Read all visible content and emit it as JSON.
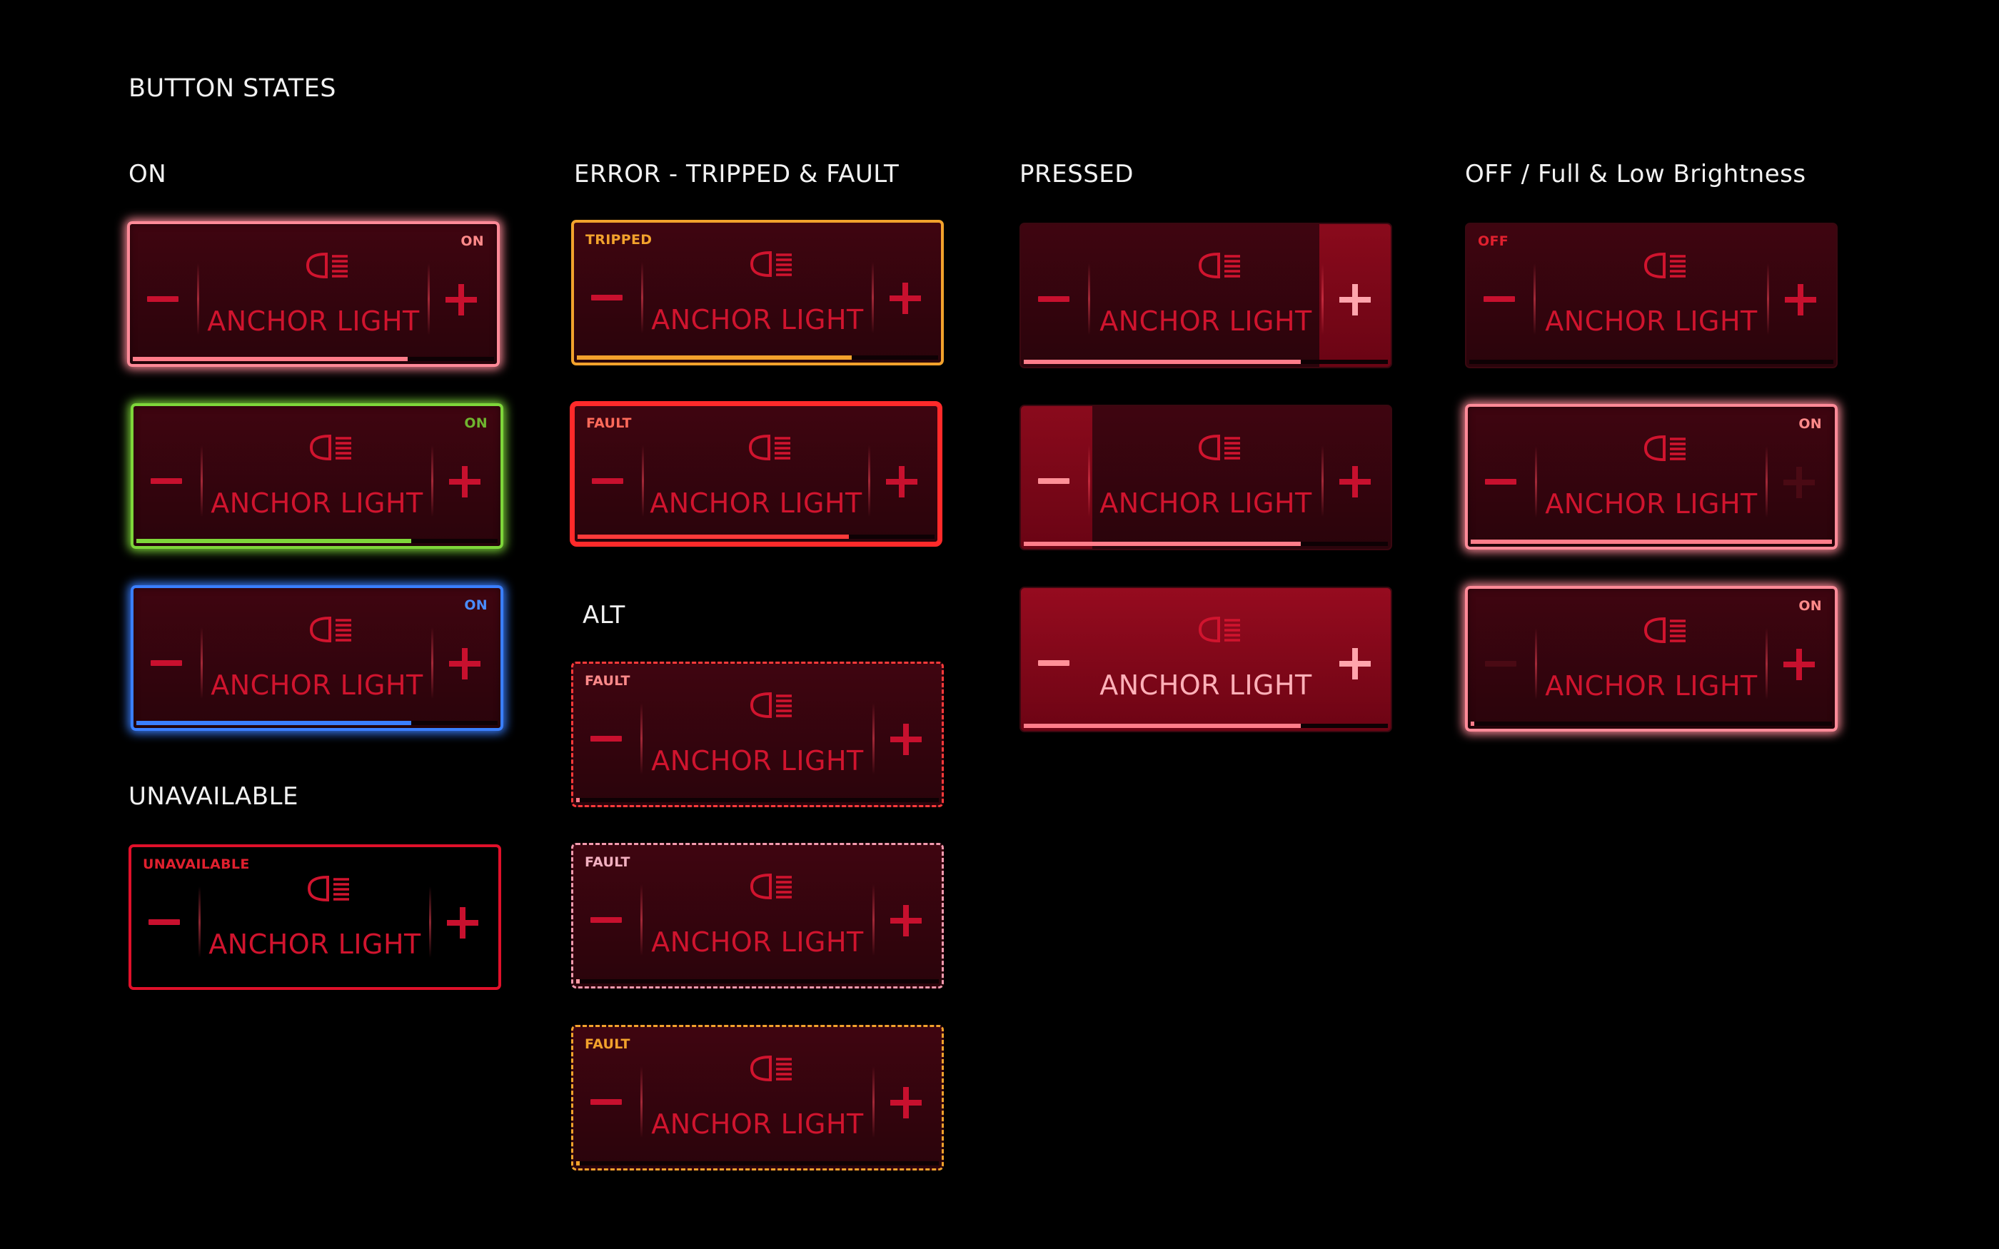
{
  "page_title": "BUTTON STATES",
  "sections": {
    "on": "ON",
    "error": "ERROR - TRIPPED & FAULT",
    "pressed": "PRESSED",
    "off_brightness": "OFF / Full & Low Brightness",
    "alt": "ALT",
    "unavailable": "UNAVAILABLE"
  },
  "button_label": "ANCHOR LIGHT",
  "icon": "headlight-icon",
  "colors": {
    "label_red": "#d0142e",
    "red_glow": "#ff8090",
    "green": "#7ed63a",
    "blue": "#3a7fff",
    "amber": "#f2a22c",
    "fault_red": "#ff2a2a",
    "pink": "#f29aae",
    "unavailable_red": "#e0102a"
  },
  "buttons": [
    {
      "id": "on-red",
      "section": "on",
      "badge": "ON",
      "badge_color": "#ff8a8a",
      "border_color": "#ff8a98",
      "level": 0.76
    },
    {
      "id": "on-green",
      "section": "on",
      "badge": "ON",
      "badge_color": "#6fb52f",
      "border_color": "#7ed63a",
      "level": 0.76
    },
    {
      "id": "on-blue",
      "section": "on",
      "badge": "ON",
      "badge_color": "#4a8dff",
      "border_color": "#3a7fff",
      "level": 0.76
    },
    {
      "id": "unavailable",
      "section": "unavailable",
      "badge": "UNAVAILABLE",
      "badge_color": "#e0202e",
      "border_color": "#e0102a"
    },
    {
      "id": "tripped",
      "section": "error",
      "badge": "TRIPPED",
      "badge_color": "#f2a22c",
      "border_color": "#f2a22c",
      "level": 0.76
    },
    {
      "id": "fault",
      "section": "error",
      "badge": "FAULT",
      "badge_color": "#ff6a5a",
      "border_color": "#ff2a2a",
      "level": 0.76
    },
    {
      "id": "alt-fault-red",
      "section": "alt",
      "badge": "FAULT",
      "badge_color": "#ff8a8a",
      "border_color": "#ff3a3a",
      "level": 0.01
    },
    {
      "id": "alt-fault-pink",
      "section": "alt",
      "badge": "FAULT",
      "badge_color": "#f2b0c0",
      "border_color": "#f29aae",
      "level": 0.01
    },
    {
      "id": "alt-fault-amber",
      "section": "alt",
      "badge": "FAULT",
      "badge_color": "#f2a22c",
      "border_color": "#f2a22c",
      "level": 0.01
    },
    {
      "id": "pressed-plus",
      "section": "pressed",
      "pressed": "plus",
      "level": 0.76
    },
    {
      "id": "pressed-minus",
      "section": "pressed",
      "pressed": "minus",
      "level": 0.76
    },
    {
      "id": "pressed-whole",
      "section": "pressed",
      "pressed": "whole",
      "level": 0.76
    },
    {
      "id": "off",
      "section": "off_brightness",
      "badge": "OFF",
      "badge_color": "#e0202e",
      "level": 0
    },
    {
      "id": "on-full",
      "section": "off_brightness",
      "badge": "ON",
      "badge_color": "#ff8a8a",
      "border_color": "#ff8a98",
      "level": 1.0,
      "plus_dim": true
    },
    {
      "id": "on-low",
      "section": "off_brightness",
      "badge": "ON",
      "badge_color": "#ff8a8a",
      "border_color": "#ff8a98",
      "level": 0.01,
      "minus_dim": true
    }
  ]
}
